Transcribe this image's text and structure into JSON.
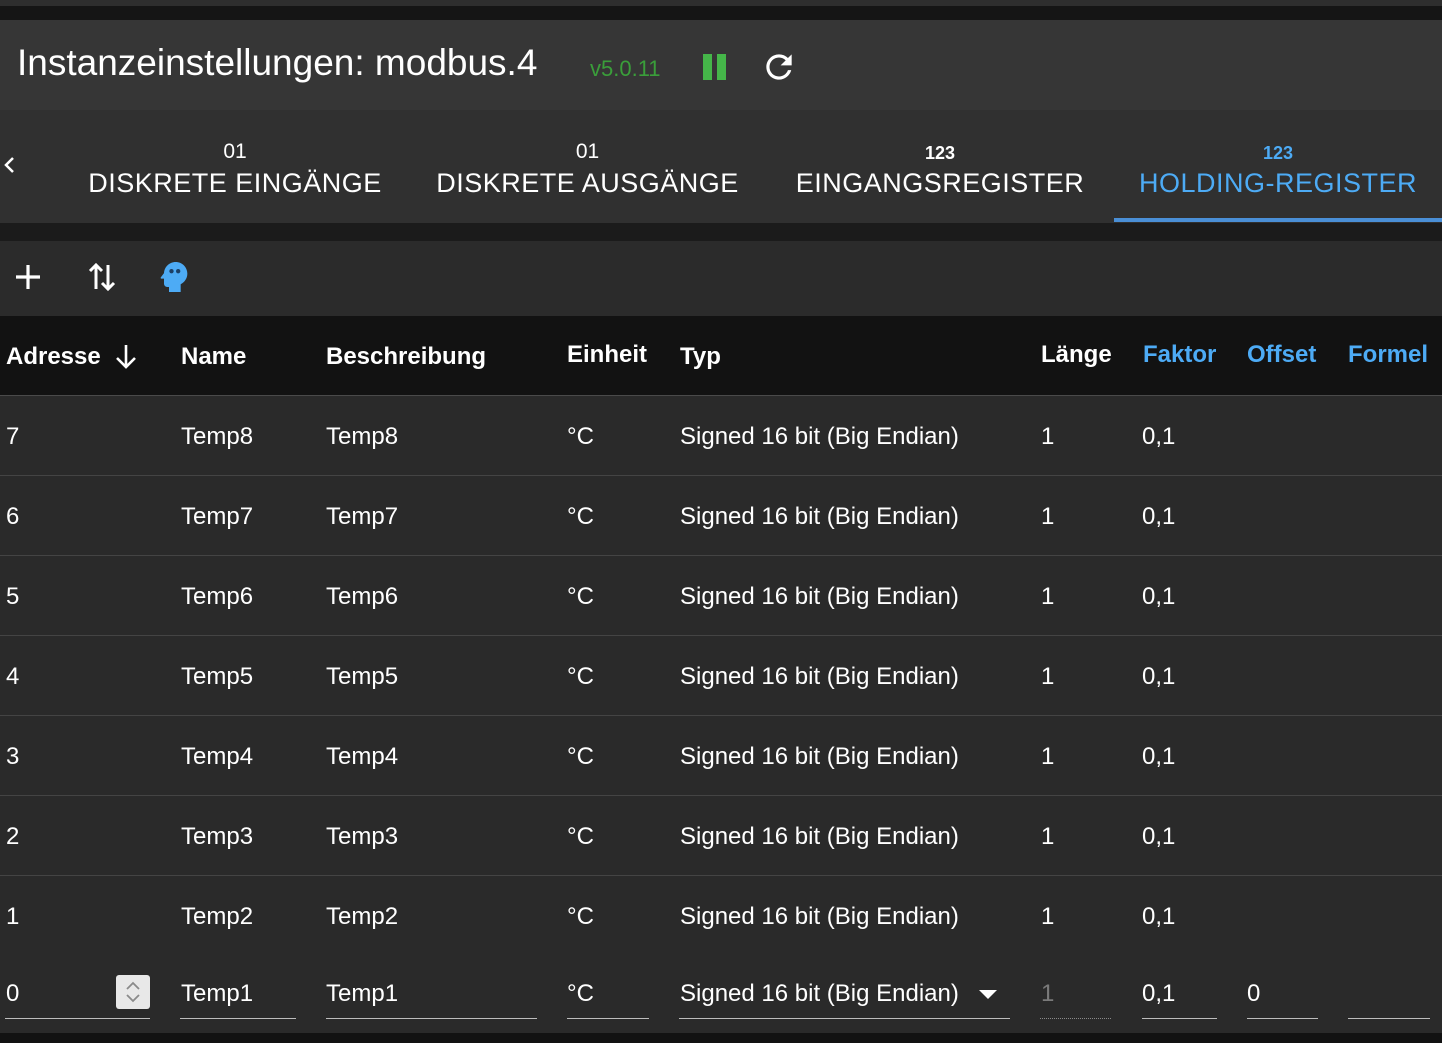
{
  "header": {
    "title": "Instanzeinstellungen: modbus.4",
    "version": "v5.0.11",
    "pause_icon": "pause-icon",
    "reload_icon": "reload-icon",
    "status_color": "#45b649"
  },
  "tabs": [
    {
      "icon": "01",
      "label": "DISKRETE EINGÄNGE",
      "active": false
    },
    {
      "icon": "01",
      "label": "DISKRETE AUSGÄNGE",
      "active": false
    },
    {
      "icon": "123",
      "label": "EINGANGSREGISTER",
      "active": false
    },
    {
      "icon": "123",
      "label": "HOLDING-REGISTER",
      "active": true
    }
  ],
  "toolbar": {
    "add_icon": "plus-icon",
    "import_export_icon": "import-export-icon",
    "expert_icon": "expert-head-icon"
  },
  "table": {
    "columns": {
      "address": "Adresse",
      "name": "Name",
      "description": "Beschreibung",
      "unit": "Einheit",
      "type": "Typ",
      "length": "Länge",
      "factor": "Faktor",
      "offset": "Offset",
      "formula": "Formel"
    },
    "rows": [
      {
        "address": "7",
        "name": "Temp8",
        "description": "Temp8",
        "unit": "°C",
        "type": "Signed 16 bit (Big Endian)",
        "length": "1",
        "factor": "0,1"
      },
      {
        "address": "6",
        "name": "Temp7",
        "description": "Temp7",
        "unit": "°C",
        "type": "Signed 16 bit (Big Endian)",
        "length": "1",
        "factor": "0,1"
      },
      {
        "address": "5",
        "name": "Temp6",
        "description": "Temp6",
        "unit": "°C",
        "type": "Signed 16 bit (Big Endian)",
        "length": "1",
        "factor": "0,1"
      },
      {
        "address": "4",
        "name": "Temp5",
        "description": "Temp5",
        "unit": "°C",
        "type": "Signed 16 bit (Big Endian)",
        "length": "1",
        "factor": "0,1"
      },
      {
        "address": "3",
        "name": "Temp4",
        "description": "Temp4",
        "unit": "°C",
        "type": "Signed 16 bit (Big Endian)",
        "length": "1",
        "factor": "0,1"
      },
      {
        "address": "2",
        "name": "Temp3",
        "description": "Temp3",
        "unit": "°C",
        "type": "Signed 16 bit (Big Endian)",
        "length": "1",
        "factor": "0,1"
      },
      {
        "address": "1",
        "name": "Temp2",
        "description": "Temp2",
        "unit": "°C",
        "type": "Signed 16 bit (Big Endian)",
        "length": "1",
        "factor": "0,1"
      }
    ],
    "edit_row": {
      "address": "0",
      "name": "Temp1",
      "description": "Temp1",
      "unit": "°C",
      "type": "Signed 16 bit (Big Endian)",
      "length": "1",
      "factor": "0,1",
      "offset": "0",
      "formula": ""
    }
  }
}
